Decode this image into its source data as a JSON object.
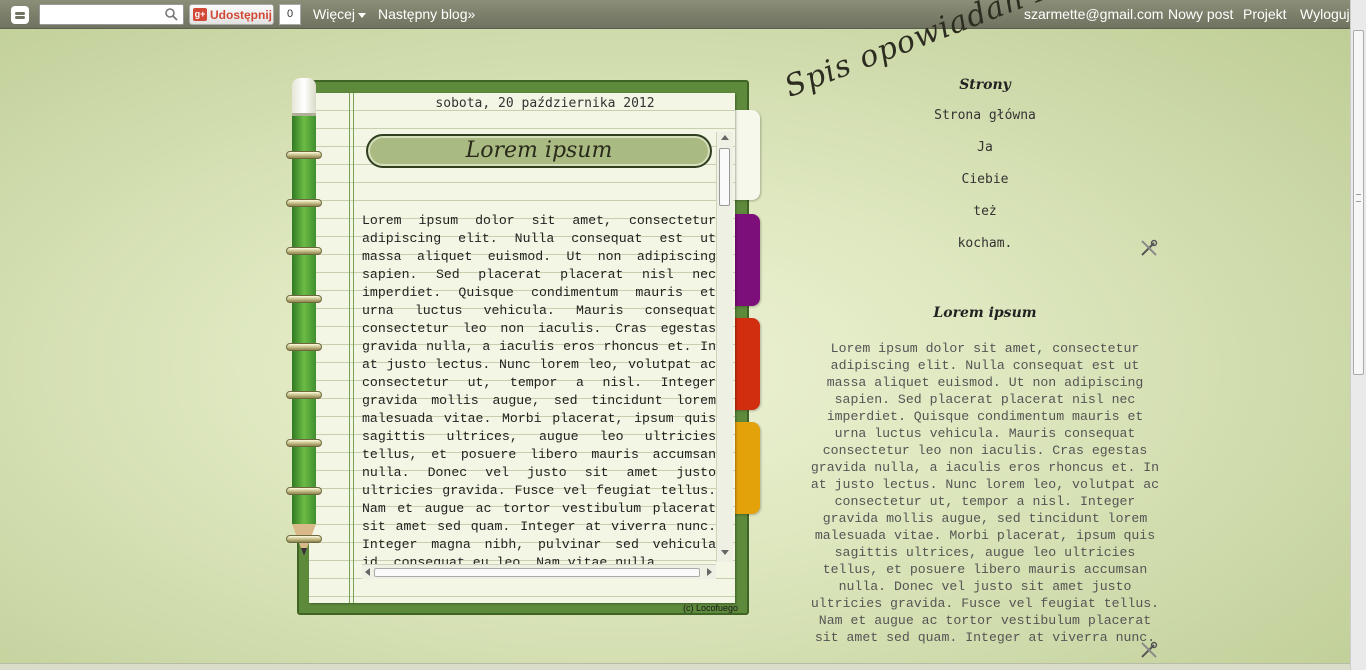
{
  "navbar": {
    "search_placeholder": "",
    "share_label": "Udostępnij",
    "share_count": "0",
    "more_label": "Więcej",
    "next_blog": "Następny blog»",
    "email": "szarmette@gmail.com",
    "new_post": "Nowy post",
    "project": "Projekt",
    "logout": "Wyloguj"
  },
  "blog": {
    "title": "Spis opowiadań FanficTion"
  },
  "post": {
    "date": "sobota, 20 października 2012",
    "title": "Lorem ipsum",
    "body": "Lorem ipsum dolor sit amet, consectetur adipiscing elit. Nulla consequat est ut massa aliquet euismod. Ut non adipiscing sapien. Sed placerat placerat nisl nec imperdiet. Quisque condimentum mauris et urna luctus vehicula. Mauris consequat consectetur leo non iaculis. Cras egestas gravida nulla, a iaculis eros rhoncus et. In at justo lectus. Nunc lorem leo, volutpat ac consectetur ut, tempor a nisl. Integer gravida mollis augue, sed tincidunt lorem malesuada vitae. Morbi placerat, ipsum quis sagittis ultrices, augue leo ultricies tellus, et posuere libero mauris accumsan nulla. Donec vel justo sit amet justo ultricies gravida. Fusce vel feugiat tellus. Nam et augue ac tortor vestibulum placerat sit amet sed quam. Integer at viverra nunc. Integer magna nibh, pulvinar sed vehicula id, consequat eu leo. Nam vitae nulla",
    "credit": "(c)  Locofuego"
  },
  "sidebar": {
    "pages_heading": "Strony",
    "pages": [
      "Strona główna",
      "Ja",
      "Ciebie",
      "też",
      "kocham."
    ],
    "text_heading": "Lorem ipsum",
    "text_body": "Lorem ipsum dolor sit amet, consectetur adipiscing elit. Nulla consequat est ut massa aliquet euismod. Ut non adipiscing sapien. Sed placerat placerat nisl nec imperdiet. Quisque condimentum mauris et urna luctus vehicula. Mauris consequat consectetur leo non iaculis. Cras egestas gravida nulla, a iaculis eros rhoncus et. In at justo lectus. Nunc lorem leo, volutpat ac consectetur ut, tempor a nisl. Integer gravida mollis augue, sed tincidunt lorem malesuada vitae. Morbi placerat, ipsum quis sagittis ultrices, augue leo ultricies tellus, et posuere libero mauris accumsan nulla. Donec vel justo sit amet justo ultricies gravida. Fusce vel feugiat tellus. Nam et augue ac tortor vestibulum placerat sit amet sed quam. Integer at viverra nunc."
  },
  "icons": {
    "blogger": "blogger-logo-icon",
    "search": "search-icon",
    "gplus": "google-plus-icon",
    "edit": "edit-tools-icon"
  },
  "colors": {
    "navbar": "#7d816c",
    "notebook_cover": "#5e8a3c",
    "tab_purple": "#7d0f7a",
    "tab_red": "#d02e0e",
    "tab_yellow": "#e3a10a"
  }
}
